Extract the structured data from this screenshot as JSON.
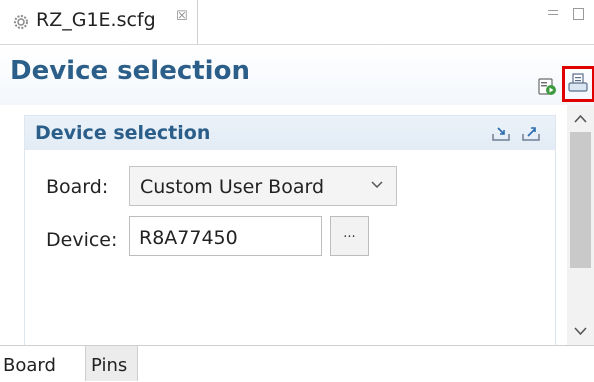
{
  "editor_tab": {
    "title": "RZ_G1E.scfg",
    "close_glyph": "☒",
    "icon": "gear-icon"
  },
  "window_controls": {
    "minimize": "minimize-icon",
    "maximize": "maximize-icon"
  },
  "form_header": {
    "title": "Device selection",
    "toolbar": [
      "generate-code-icon",
      "generate-report-icon"
    ],
    "highlight_color": "#e00000"
  },
  "section": {
    "title": "Device selection",
    "actions": [
      "import-icon",
      "export-icon"
    ],
    "board": {
      "label": "Board:",
      "value": "Custom User Board"
    },
    "device": {
      "label": "Device:",
      "value": "R8A77450",
      "browse_label": "..."
    }
  },
  "bottom_tabs": [
    "Board",
    "Pins"
  ],
  "colors": {
    "heading": "#2b5f8a",
    "section_header_bg": "#e6eef7"
  }
}
